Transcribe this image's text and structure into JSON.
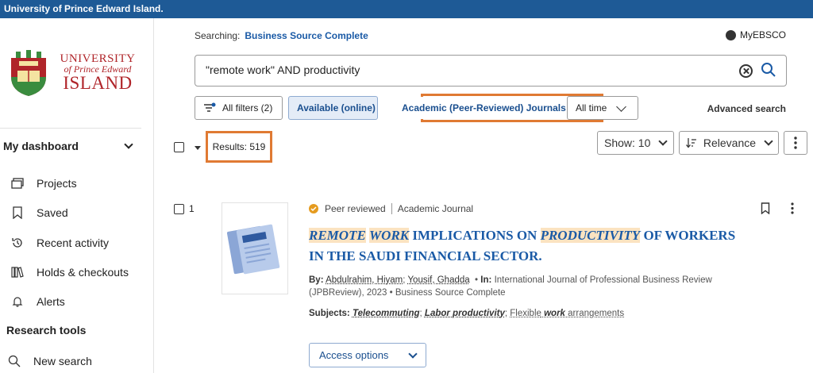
{
  "topbar": {
    "title": "University of Prince Edward Island."
  },
  "logo": {
    "line1": "UNIVERSITY",
    "line2": "of Prince Edward",
    "line3": "ISLAND",
    "colors": {
      "crest_red": "#b0252a",
      "crest_green": "#3a8c3f"
    }
  },
  "sidebar": {
    "dashboard_label": "My dashboard",
    "items": [
      {
        "label": "Projects",
        "icon": "folders-icon"
      },
      {
        "label": "Saved",
        "icon": "bookmark-icon"
      },
      {
        "label": "Recent activity",
        "icon": "history-icon"
      },
      {
        "label": "Holds & checkouts",
        "icon": "books-icon"
      },
      {
        "label": "Alerts",
        "icon": "bell-icon"
      }
    ],
    "research_tools_label": "Research tools",
    "new_search_label": "New search"
  },
  "header": {
    "searching_label": "Searching:",
    "database": "Business Source Complete",
    "account_label": "MyEBSCO"
  },
  "search": {
    "query": "\"remote work\" AND productivity"
  },
  "filters": {
    "all_filters": "All filters (2)",
    "available": "Available (online)",
    "academic": "Academic (Peer-Reviewed) Journals",
    "time": "All time",
    "advanced": "Advanced search"
  },
  "results": {
    "count_label": "Results: 519",
    "show_label": "Show: 10",
    "sort_label": "Relevance"
  },
  "result_items": [
    {
      "index": "1",
      "peer_reviewed": "Peer reviewed",
      "type": "Academic Journal",
      "title_parts": [
        "REMOTE",
        "WORK",
        "IMPLICATIONS ON",
        "PRODUCTIVITY",
        "OF WORKERS IN THE SAUDI FINANCIAL SECTOR."
      ],
      "by_label": "By:",
      "author1": "Abdulrahim, Hiyam",
      "author2": "Yousif, Ghadda",
      "in_label": "In:",
      "source": "International Journal of Professional Business Review (JPBReview), 2023 • Business Source Complete",
      "subjects_label": "Subjects:",
      "subject1": "Telecommuting",
      "subject2": "Labor productivity",
      "subject3_pre": "Flexible",
      "subject3_em": "work",
      "subject3_post": "arrangements",
      "access_label": "Access options"
    }
  ]
}
